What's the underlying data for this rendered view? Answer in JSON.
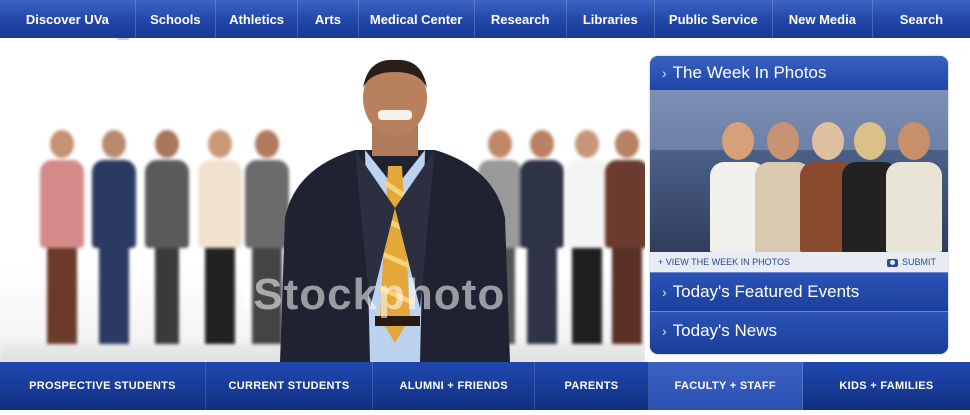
{
  "topnav": [
    {
      "label": "Discover UVa"
    },
    {
      "label": "Schools"
    },
    {
      "label": "Athletics"
    },
    {
      "label": "Arts"
    },
    {
      "label": "Medical Center"
    },
    {
      "label": "Research"
    },
    {
      "label": "Libraries"
    },
    {
      "label": "Public Service"
    },
    {
      "label": "New Media"
    },
    {
      "label": "Search"
    }
  ],
  "hero": {
    "watermark": "iStockphoto"
  },
  "panel": {
    "week_title": "The Week In Photos",
    "view_link": "+ VIEW THE WEEK IN PHOTOS",
    "submit": "SUBMIT",
    "featured_events": "Today's Featured Events",
    "news": "Today's News"
  },
  "bottomnav": [
    {
      "label": "PROSPECTIVE STUDENTS"
    },
    {
      "label": "CURRENT STUDENTS"
    },
    {
      "label": "ALUMNI + FRIENDS"
    },
    {
      "label": "PARENTS"
    },
    {
      "label": "FACULTY + STAFF"
    },
    {
      "label": "KIDS + FAMILIES"
    }
  ],
  "colors": {
    "nav_blue": "#2146a8",
    "panel_blue": "#1c3f9c",
    "active_tab": "#2a50b2"
  }
}
